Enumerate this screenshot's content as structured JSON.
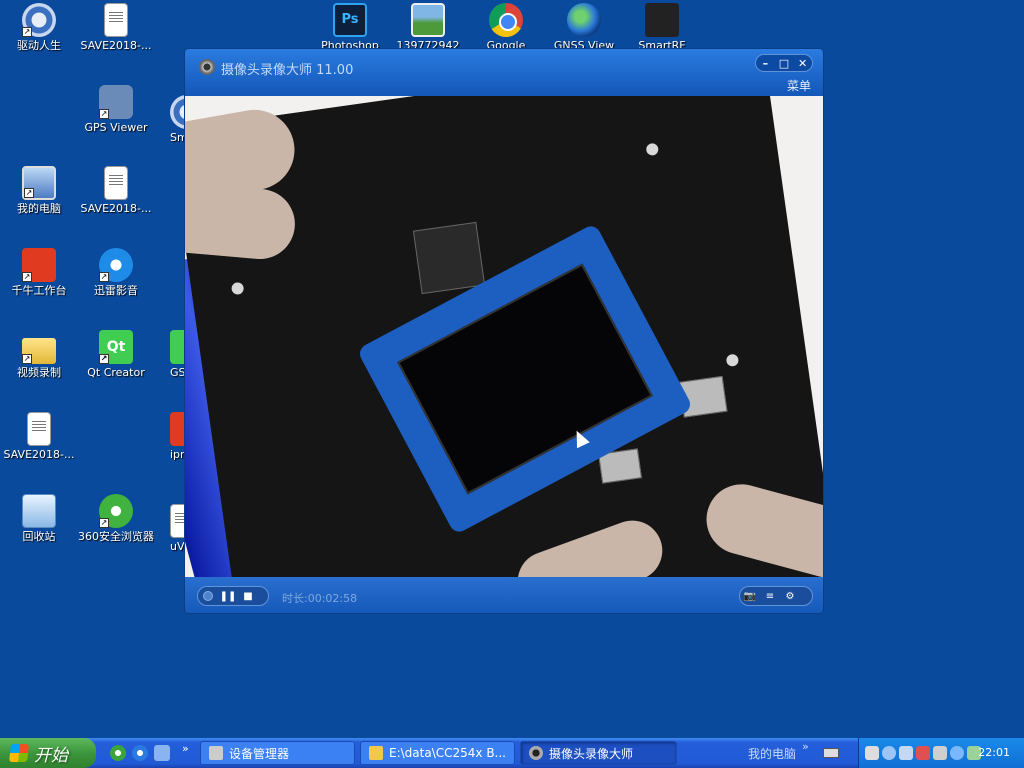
{
  "desktop": {
    "icons": [
      {
        "label": "驱动人生"
      },
      {
        "label": "SAVE2018-..."
      },
      {
        "label": "GPS Viewer"
      },
      {
        "label": "Sm St"
      },
      {
        "label": "我的电脑"
      },
      {
        "label": "SAVE2018-..."
      },
      {
        "label": "千牛工作台"
      },
      {
        "label": "迅雷影音"
      },
      {
        "label": "视频录制"
      },
      {
        "label": "Qt Creator"
      },
      {
        "label": "GSM 助"
      },
      {
        "label": "SAVE2018-..."
      },
      {
        "label": "ipm"
      },
      {
        "label": "回收站"
      },
      {
        "label": "360安全浏览器"
      },
      {
        "label": "uV"
      },
      {
        "label": "Photoshop"
      },
      {
        "label": "139772942"
      },
      {
        "label": "Google"
      },
      {
        "label": "GNSS View"
      },
      {
        "label": "SmartRF"
      }
    ]
  },
  "window": {
    "title": "摄像头录像大师 11.00",
    "menu_label": "菜单",
    "controls": {
      "minimize": "–",
      "maximize": "□",
      "close": "✕"
    },
    "player": {
      "duration_label": "时长",
      "duration_value": "00:02:58",
      "pause": "❚❚",
      "stop": "■",
      "snapshot": "📷",
      "list": "≡",
      "settings": "⚙"
    }
  },
  "taskbar": {
    "start_label": "开始",
    "quicklaunch_more": "»",
    "tasks": [
      {
        "label": "设备管理器"
      },
      {
        "label": "E:\\data\\CC254x B..."
      },
      {
        "label": "摄像头录像大师"
      }
    ],
    "mypc_label": "我的电脑",
    "mypc_more": "»",
    "clock": "22:01"
  },
  "colors": {
    "desktop_bg": "#0a4a9c",
    "window_blue": "#1560c4",
    "taskbar_blue": "#245edb",
    "start_green": "#3c963c"
  }
}
